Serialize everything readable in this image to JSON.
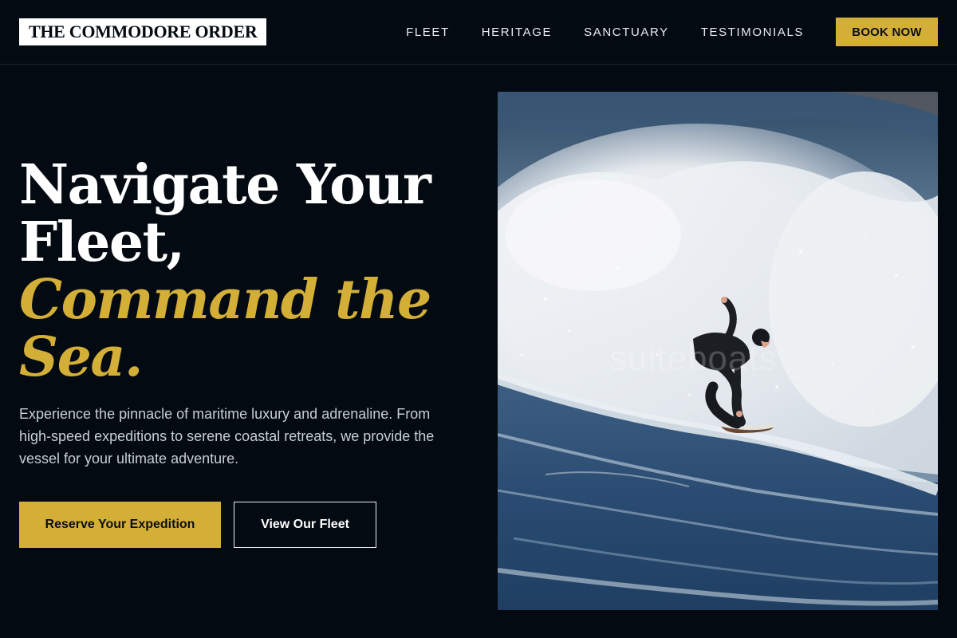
{
  "brand": {
    "logo_text": "THE COMMODORE ORDER"
  },
  "nav": {
    "links": [
      "FLEET",
      "HERITAGE",
      "SANCTUARY",
      "TESTIMONIALS"
    ],
    "cta_label": "BOOK NOW"
  },
  "hero": {
    "title_line1": "Navigate Your",
    "title_line2": "Fleet,",
    "accent_line1": "Command the",
    "accent_line2": "Sea.",
    "description": "Experience the pinnacle of maritime luxury and adrenaline. From high-speed expeditions to serene coastal retreats, we provide the vessel for your ultimate adventure.",
    "primary_button": "Reserve Your Expedition",
    "secondary_button": "View Our Fleet"
  },
  "image": {
    "watermark": "suiteboats"
  },
  "colors": {
    "background": "#030a12",
    "accent": "#d4af37",
    "text": "#ffffff",
    "muted_text": "#c9ced6"
  }
}
